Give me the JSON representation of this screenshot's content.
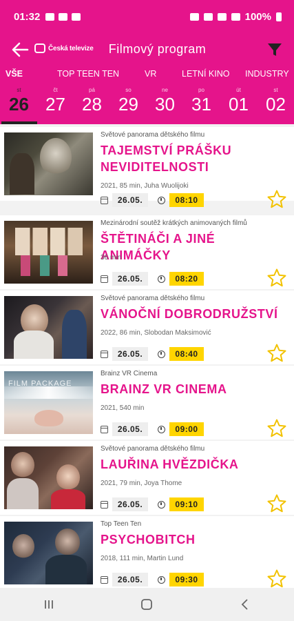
{
  "status_bar": {
    "time": "01:32",
    "battery": "100%"
  },
  "header": {
    "logo_text": "Česká televize",
    "title": "Filmový program"
  },
  "categories": [
    "VŠE",
    "TOP TEEN TEN",
    "VR",
    "LETNÍ KINO",
    "INDUSTRY"
  ],
  "days": [
    {
      "weekday": "st",
      "num": "26"
    },
    {
      "weekday": "čt",
      "num": "27"
    },
    {
      "weekday": "pá",
      "num": "28"
    },
    {
      "weekday": "so",
      "num": "29"
    },
    {
      "weekday": "ne",
      "num": "30"
    },
    {
      "weekday": "po",
      "num": "31"
    },
    {
      "weekday": "út",
      "num": "01"
    },
    {
      "weekday": "st",
      "num": "02"
    }
  ],
  "films": [
    {
      "section": "Světové panorama dětského filmu",
      "title": "TAJEMSTVÍ PRÁŠKU NEVIDITELNOSTI",
      "meta": "2021, 85 min, Juha Wuolijoki",
      "date": "26.05.",
      "time": "08:10"
    },
    {
      "section": "Mezinárodní soutěž krátkých animovaných filmů",
      "title": "ŠTĚTINÁČI A JINÉ ANIMÁČKY",
      "meta": "36 min",
      "date": "26.05.",
      "time": "08:20"
    },
    {
      "section": "Světové panorama dětského filmu",
      "title": "VÁNOČNÍ DOBRODRUŽSTVÍ",
      "meta": "2022, 86 min, Slobodan Maksimović",
      "date": "26.05.",
      "time": "08:40"
    },
    {
      "section": "Brainz VR Cinema",
      "title": "BRAINZ VR CINEMA",
      "meta": "2021, 540 min",
      "date": "26.05.",
      "time": "09:00",
      "thumb_label": "FILM PACKAGE"
    },
    {
      "section": "Světové panorama dětského filmu",
      "title": "LAUŘINA HVĚZDIČKA",
      "meta": "2021, 79 min, Joya Thome",
      "date": "26.05.",
      "time": "09:10"
    },
    {
      "section": "Top Teen Ten",
      "title": "PSYCHOBITCH",
      "meta": "2018, 111 min, Martin Lund",
      "date": "26.05.",
      "time": "09:30"
    }
  ],
  "colors": {
    "accent": "#e5148b",
    "time_highlight": "#ffd500",
    "star": "#f2c200"
  }
}
